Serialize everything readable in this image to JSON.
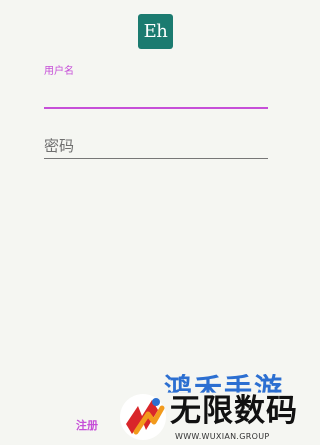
{
  "app": {
    "logo_text": "Eh",
    "logo_color": "#1b7b70"
  },
  "login": {
    "username_label": "用户名",
    "username_value": "",
    "password_placeholder": "密码",
    "password_value": "",
    "register_label": "注册",
    "accent_color": "#c64fd8"
  },
  "watermark": {
    "line1": "鸿禾手游",
    "name": "无限数码",
    "url": "WWW.WUXIAN.GROUP",
    "icon": "wuxian-logo-icon"
  }
}
